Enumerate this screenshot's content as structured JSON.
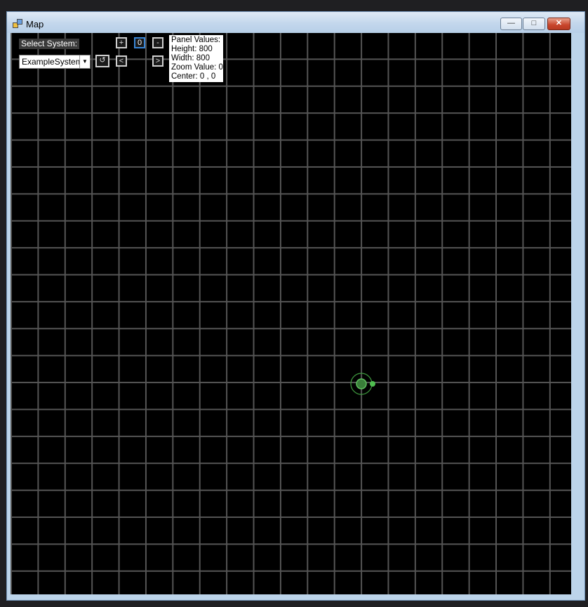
{
  "window": {
    "title": "Map"
  },
  "controls": {
    "select_label": "Select System:",
    "system_selected": "ExampleSystem",
    "zoom_in": "+",
    "zoom_reset": "0",
    "zoom_out": "-",
    "prev": "<",
    "next": ">",
    "refresh_icon": "refresh-icon"
  },
  "panel": {
    "heading": "Panel Values:",
    "height": "Height: 800",
    "width": "Width: 800",
    "zoom": "Zoom Value: 0",
    "center": "Center: 0 , 0"
  },
  "colors": {
    "grid": "#555555",
    "background": "#000000",
    "orbit": "#3f9a3f",
    "planet": "#4fbf4f"
  }
}
